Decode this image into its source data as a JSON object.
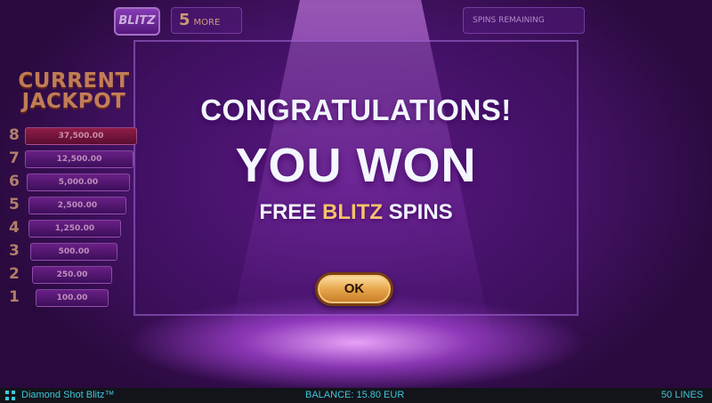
{
  "topbar": {
    "logo_text": "BLITZ",
    "more_count": "5",
    "more_label": "MORE",
    "spins_label": "SPINS REMAINING"
  },
  "jackpot": {
    "title_line1": "CURRENT",
    "title_line2": "JACKPOT",
    "rows": [
      {
        "count": "8",
        "amount": "37,500.00"
      },
      {
        "count": "7",
        "amount": "12,500.00"
      },
      {
        "count": "6",
        "amount": "5,000.00"
      },
      {
        "count": "5",
        "amount": "2,500.00"
      },
      {
        "count": "4",
        "amount": "1,250.00"
      },
      {
        "count": "3",
        "amount": "500.00"
      },
      {
        "count": "2",
        "amount": "250.00"
      },
      {
        "count": "1",
        "amount": "100.00"
      }
    ]
  },
  "dialog": {
    "congratulations": "CONGRATULATIONS!",
    "you_won": "YOU WON",
    "free_word": "FREE",
    "blitz_word": "BLITZ",
    "spins_word": "SPINS",
    "ok_label": "OK"
  },
  "status_bar": {
    "game_name": "Diamond Shot Blitz™",
    "balance": "BALANCE: 15.80 EUR",
    "lines": "50 LINES"
  },
  "colors": {
    "accent_gold": "#f5c26b",
    "status_text": "#3ec7d8",
    "background": "#2a0a3e"
  }
}
